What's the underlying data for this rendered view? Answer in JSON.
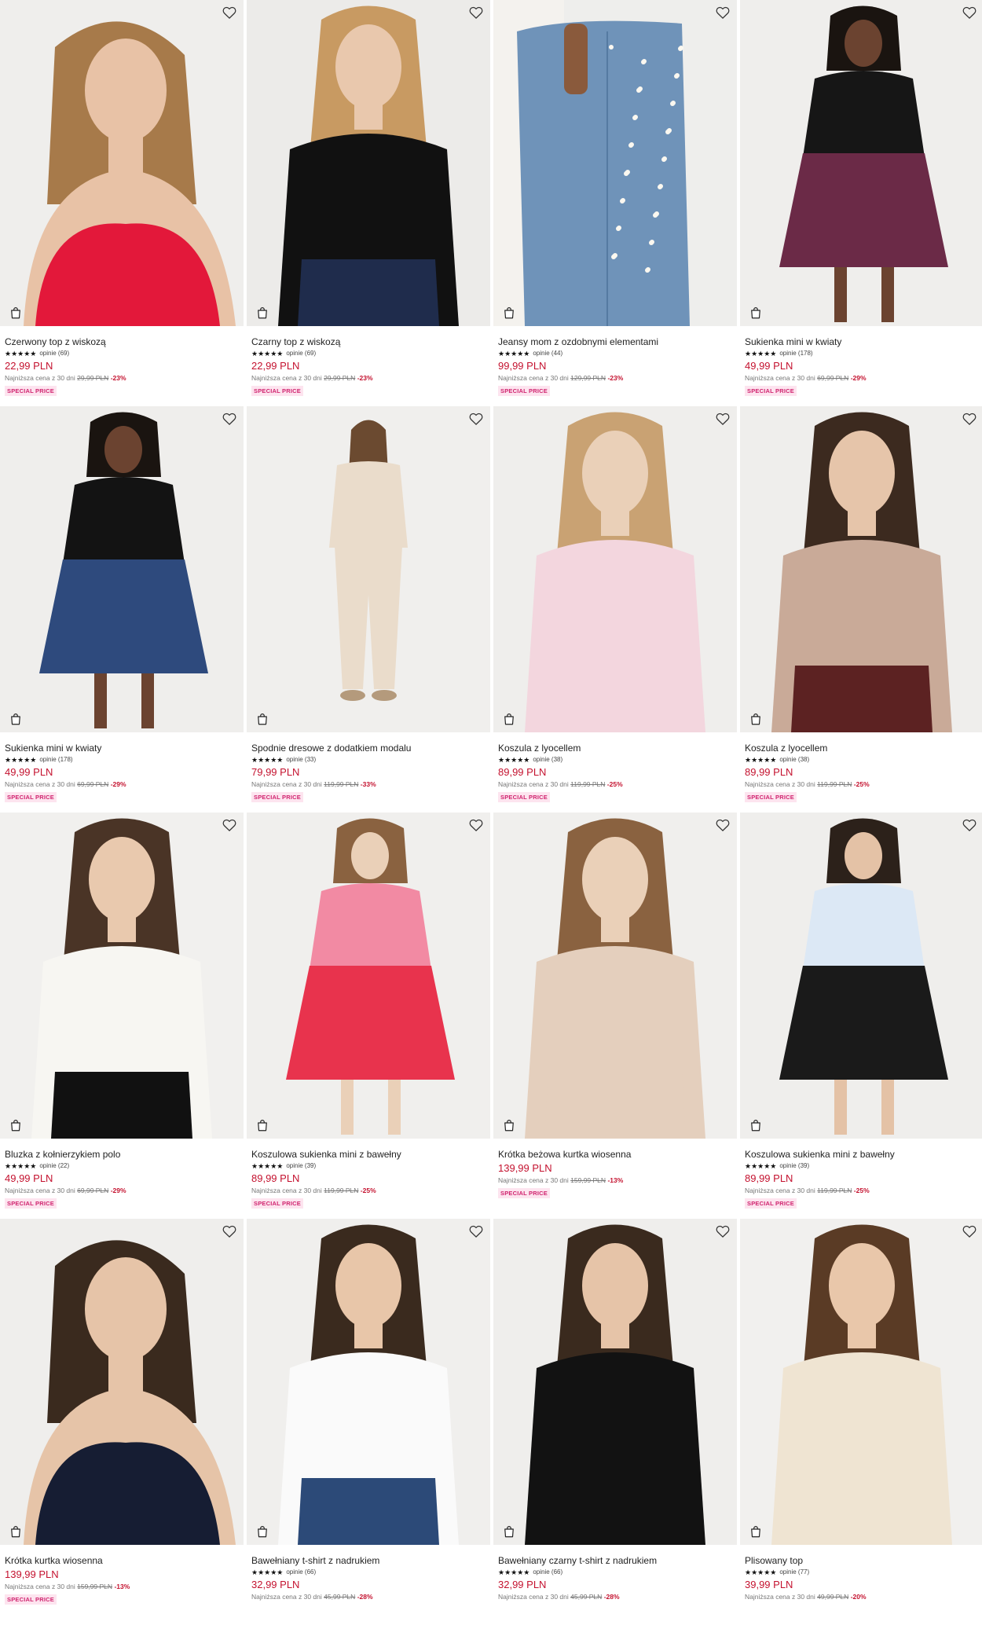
{
  "icons": {
    "wishlist": "heart-outline-icon",
    "cart": "shopping-bag-icon"
  },
  "colors": {
    "price": "#c4122f",
    "badge_text": "#d0246f",
    "badge_bg": "#fde4ef"
  },
  "products": [
    {
      "name": "Czerwony top z wiskozą",
      "stars": "★★★★★",
      "opinie": "opinie (69)",
      "price": "22,99 PLN",
      "lowest_prefix": "Najniższa cena z 30 dni",
      "old_price": "29,99 PLN",
      "discount": "-23%",
      "badge": "SPECIAL PRICE",
      "bg": "#efeeec",
      "top": "#e3183a",
      "bottom": "#efeeec",
      "skin": "#e8c2a6",
      "hair": "#a77a4a",
      "shot": "portrait"
    },
    {
      "name": "Czarny top z wiskozą",
      "stars": "★★★★★",
      "opinie": "opinie (69)",
      "price": "22,99 PLN",
      "lowest_prefix": "Najniższa cena z 30 dni",
      "old_price": "29,99 PLN",
      "discount": "-23%",
      "badge": "SPECIAL PRICE",
      "bg": "#ecebe9",
      "top": "#111111",
      "bottom": "#1f2c4c",
      "skin": "#e9c8ad",
      "hair": "#c89a62",
      "shot": "half"
    },
    {
      "name": "Jeansy mom z ozdobnymi elementami",
      "stars": "★★★★★",
      "opinie": "opinie (44)",
      "price": "99,99 PLN",
      "lowest_prefix": "Najniższa cena z 30 dni",
      "old_price": "129,99 PLN",
      "discount": "-23%",
      "badge": "SPECIAL PRICE",
      "bg": "#eeeeec",
      "top": "#f4f2ee",
      "bottom": "#6f93b9",
      "skin": "#8a5a3c",
      "hair": "#222",
      "shot": "jeans"
    },
    {
      "name": "Sukienka mini w kwiaty",
      "stars": "★★★★★",
      "opinie": "opinie (178)",
      "price": "49,99 PLN",
      "lowest_prefix": "Najniższa cena z 30 dni",
      "old_price": "69,99 PLN",
      "discount": "-29%",
      "badge": "SPECIAL PRICE",
      "bg": "#efeeec",
      "top": "#161616",
      "bottom": "#6b2a47",
      "skin": "#6b4330",
      "hair": "#1a1410",
      "shot": "dress"
    },
    {
      "name": "Sukienka mini w kwiaty",
      "stars": "★★★★★",
      "opinie": "opinie (178)",
      "price": "49,99 PLN",
      "lowest_prefix": "Najniższa cena z 30 dni",
      "old_price": "69,99 PLN",
      "discount": "-29%",
      "badge": "SPECIAL PRICE",
      "bg": "#efeeec",
      "top": "#131313",
      "bottom": "#2e4a7d",
      "skin": "#6b4330",
      "hair": "#1a1410",
      "shot": "dress"
    },
    {
      "name": "Spodnie dresowe z dodatkiem modalu",
      "stars": "★★★★★",
      "opinie": "opinie (33)",
      "price": "79,99 PLN",
      "lowest_prefix": "Najniższa cena z 30 dni",
      "old_price": "119,99 PLN",
      "discount": "-33%",
      "badge": "SPECIAL PRICE",
      "bg": "#f0efed",
      "top": "#eadccb",
      "bottom": "#eadccb",
      "skin": "#e6c4a8",
      "hair": "#6b4a30",
      "shot": "full"
    },
    {
      "name": "Koszula z lyocellem",
      "stars": "★★★★★",
      "opinie": "opinie (38)",
      "price": "89,99 PLN",
      "lowest_prefix": "Najniższa cena z 30 dni",
      "old_price": "119,99 PLN",
      "discount": "-25%",
      "badge": "SPECIAL PRICE",
      "bg": "#efeeec",
      "top": "#f3d6de",
      "bottom": "#f3d6de",
      "skin": "#ead0b8",
      "hair": "#c9a273",
      "shot": "half"
    },
    {
      "name": "Koszula z lyocellem",
      "stars": "★★★★★",
      "opinie": "opinie (38)",
      "price": "89,99 PLN",
      "lowest_prefix": "Najniższa cena z 30 dni",
      "old_price": "119,99 PLN",
      "discount": "-25%",
      "badge": "SPECIAL PRICE",
      "bg": "#efeeec",
      "top": "#c9aa98",
      "bottom": "#5c2222",
      "skin": "#e6c5aa",
      "hair": "#3c2a1f",
      "shot": "half"
    },
    {
      "name": "Bluzka z kołnierzykiem polo",
      "stars": "★★★★★",
      "opinie": "opinie (22)",
      "price": "49,99 PLN",
      "lowest_prefix": "Najniższa cena z 30 dni",
      "old_price": "69,99 PLN",
      "discount": "-29%",
      "badge": "SPECIAL PRICE",
      "bg": "#f1f0ee",
      "top": "#f7f6f2",
      "bottom": "#111111",
      "skin": "#e9c9ae",
      "hair": "#4a3426",
      "shot": "half"
    },
    {
      "name": "Koszulowa sukienka mini z bawełny",
      "stars": "★★★★★",
      "opinie": "opinie (39)",
      "price": "89,99 PLN",
      "lowest_prefix": "Najniższa cena z 30 dni",
      "old_price": "119,99 PLN",
      "discount": "-25%",
      "badge": "SPECIAL PRICE",
      "bg": "#f0efed",
      "top": "#f28aa3",
      "bottom": "#e8334d",
      "skin": "#ead0b8",
      "hair": "#8a6240",
      "shot": "dress"
    },
    {
      "name": "Krótka beżowa kurtka wiosenna",
      "stars": "",
      "opinie": "",
      "price": "139,99 PLN",
      "lowest_prefix": "Najniższa cena z 30 dni",
      "old_price": "159,99 PLN",
      "discount": "-13%",
      "badge": "SPECIAL PRICE",
      "bg": "#f0efed",
      "top": "#e4cfbd",
      "bottom": "#e4cfbd",
      "skin": "#ead0b8",
      "hair": "#8a6240",
      "shot": "half"
    },
    {
      "name": "Koszulowa sukienka mini z bawełny",
      "stars": "★★★★★",
      "opinie": "opinie (39)",
      "price": "89,99 PLN",
      "lowest_prefix": "Najniższa cena z 30 dni",
      "old_price": "119,99 PLN",
      "discount": "-25%",
      "badge": "SPECIAL PRICE",
      "bg": "#efeeec",
      "top": "#dce8f5",
      "bottom": "#1a1a1a",
      "skin": "#e4c2a6",
      "hair": "#2c211a",
      "shot": "dress"
    },
    {
      "name": "Krótka kurtka wiosenna",
      "stars": "",
      "opinie": "",
      "price": "139,99 PLN",
      "lowest_prefix": "Najniższa cena z 30 dni",
      "old_price": "159,99 PLN",
      "discount": "-13%",
      "badge": "SPECIAL PRICE",
      "bg": "#efeeec",
      "top": "#161d33",
      "bottom": "#161d33",
      "skin": "#e6c4a8",
      "hair": "#3a2a1e",
      "shot": "portrait"
    },
    {
      "name": "Bawełniany t-shirt z nadrukiem",
      "stars": "★★★★★",
      "opinie": "opinie (66)",
      "price": "32,99 PLN",
      "lowest_prefix": "Najniższa cena z 30 dni",
      "old_price": "45,99 PLN",
      "discount": "-28%",
      "badge": "",
      "bg": "#f0efed",
      "top": "#fafafa",
      "bottom": "#2c4a78",
      "skin": "#e8c6a9",
      "hair": "#3a2a1e",
      "shot": "half"
    },
    {
      "name": "Bawełniany czarny t-shirt z nadrukiem",
      "stars": "★★★★★",
      "opinie": "opinie (66)",
      "price": "32,99 PLN",
      "lowest_prefix": "Najniższa cena z 30 dni",
      "old_price": "45,99 PLN",
      "discount": "-28%",
      "badge": "",
      "bg": "#efeeec",
      "top": "#121212",
      "bottom": "#121212",
      "skin": "#e6c4a8",
      "hair": "#3a2a1e",
      "shot": "half"
    },
    {
      "name": "Plisowany top",
      "stars": "★★★★★",
      "opinie": "opinie (77)",
      "price": "39,99 PLN",
      "lowest_prefix": "Najniższa cena z 30 dni",
      "old_price": "49,99 PLN",
      "discount": "-20%",
      "badge": "",
      "bg": "#f1f0ee",
      "top": "#efe4d2",
      "bottom": "#efe4d2",
      "skin": "#e9c7aa",
      "hair": "#5a3b25",
      "shot": "half"
    }
  ]
}
